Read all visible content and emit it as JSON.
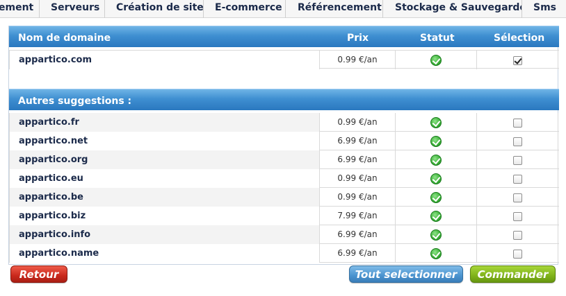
{
  "nav": {
    "tabs": [
      "ement",
      "Serveurs",
      "Création de site",
      "E-commerce",
      "Référencement",
      "Stockage & Sauvegarde",
      "Sms"
    ]
  },
  "table": {
    "headers": {
      "domain": "Nom de domaine",
      "price": "Prix",
      "status": "Statut",
      "selection": "Sélection"
    },
    "main_row": {
      "domain": "appartico.com",
      "price": "0.99 €/an",
      "status": "available",
      "selected": true
    },
    "suggestions_title": "Autres suggestions :",
    "suggestions": [
      {
        "domain": "appartico.fr",
        "price": "0.99 €/an",
        "status": "available",
        "selected": false
      },
      {
        "domain": "appartico.net",
        "price": "6.99 €/an",
        "status": "available",
        "selected": false
      },
      {
        "domain": "appartico.org",
        "price": "6.99 €/an",
        "status": "available",
        "selected": false
      },
      {
        "domain": "appartico.eu",
        "price": "0.99 €/an",
        "status": "available",
        "selected": false
      },
      {
        "domain": "appartico.be",
        "price": "0.99 €/an",
        "status": "available",
        "selected": false
      },
      {
        "domain": "appartico.biz",
        "price": "7.99 €/an",
        "status": "available",
        "selected": false
      },
      {
        "domain": "appartico.info",
        "price": "6.99 €/an",
        "status": "available",
        "selected": false
      },
      {
        "domain": "appartico.name",
        "price": "6.99 €/an",
        "status": "available",
        "selected": false
      }
    ]
  },
  "buttons": {
    "back": "Retour",
    "select_all": "Tout selectionner",
    "order": "Commander"
  },
  "colors": {
    "header_blue": "#3f8fd1",
    "back_red": "#c9281c",
    "select_all_blue": "#4a93cf",
    "order_green": "#7fb21a",
    "status_green": "#3fb33b"
  }
}
